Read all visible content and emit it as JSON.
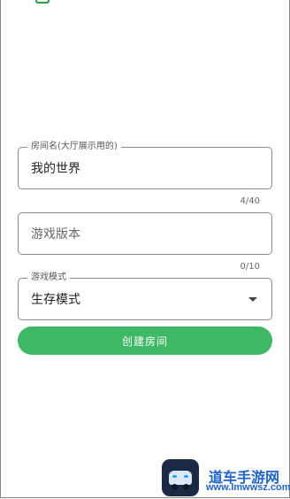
{
  "form": {
    "room_name": {
      "label": "房间名(大厅展示用的)",
      "value": "我的世界",
      "counter": "4/40"
    },
    "game_version": {
      "placeholder": "游戏版本",
      "counter": "0/10"
    },
    "game_mode": {
      "label": "游戏模式",
      "value": "生存模式"
    },
    "create_button": "创建房间"
  },
  "watermark": {
    "title": "道车手游网",
    "url": "www.lmwwsz.com"
  },
  "colors": {
    "primary_button": "#3fb866",
    "border": "#8a8a8a",
    "watermark": "#1f63c8"
  }
}
